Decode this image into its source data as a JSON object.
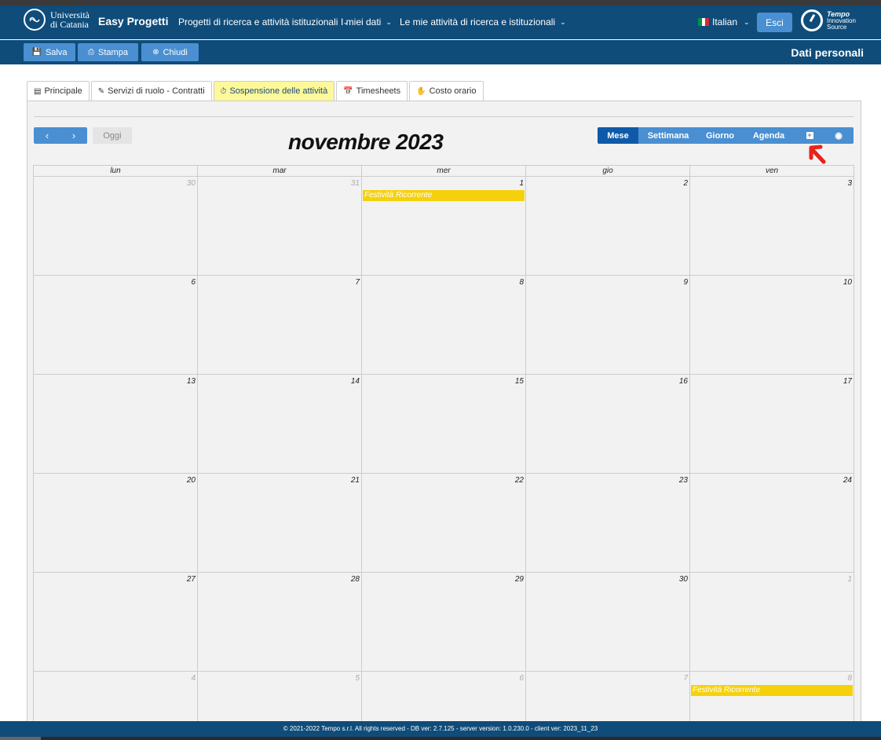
{
  "navbar": {
    "university_line1": "Università",
    "university_line2": "di Catania",
    "app_name": "Easy Progetti",
    "menu": [
      {
        "label": "Progetti di ricerca e attività istituzionali"
      },
      {
        "label": "I miei dati"
      },
      {
        "label": "Le mie attività di ricerca e istituzionali"
      }
    ],
    "language": "Italian",
    "logout_label": "Esci",
    "brand_line1": "Tempo",
    "brand_line2": "Innovation",
    "brand_line3": "Source"
  },
  "toolbar": {
    "save_label": "Salva",
    "print_label": "Stampa",
    "close_label": "Chiudi",
    "page_title": "Dati personali"
  },
  "tabs": [
    {
      "label": "Principale",
      "active": false
    },
    {
      "label": "Servizi di ruolo - Contratti",
      "active": false
    },
    {
      "label": "Sospensione delle attività",
      "active": true
    },
    {
      "label": "Timesheets",
      "active": false
    },
    {
      "label": "Costo orario",
      "active": false
    }
  ],
  "calendar": {
    "title": "novembre 2023",
    "today_label": "Oggi",
    "views": [
      "Mese",
      "Settimana",
      "Giorno",
      "Agenda"
    ],
    "active_view": "Mese",
    "day_headers": [
      "lun",
      "mar",
      "mer",
      "gio",
      "ven"
    ],
    "weeks": [
      [
        {
          "n": "30",
          "other": true
        },
        {
          "n": "31",
          "other": true
        },
        {
          "n": "1",
          "event": "Festività Ricorrente"
        },
        {
          "n": "2"
        },
        {
          "n": "3"
        }
      ],
      [
        {
          "n": "6"
        },
        {
          "n": "7"
        },
        {
          "n": "8"
        },
        {
          "n": "9"
        },
        {
          "n": "10"
        }
      ],
      [
        {
          "n": "13"
        },
        {
          "n": "14"
        },
        {
          "n": "15"
        },
        {
          "n": "16"
        },
        {
          "n": "17"
        }
      ],
      [
        {
          "n": "20"
        },
        {
          "n": "21"
        },
        {
          "n": "22"
        },
        {
          "n": "23"
        },
        {
          "n": "24"
        }
      ],
      [
        {
          "n": "27"
        },
        {
          "n": "28"
        },
        {
          "n": "29"
        },
        {
          "n": "30"
        },
        {
          "n": "1",
          "other": true
        }
      ],
      [
        {
          "n": "4",
          "other": true
        },
        {
          "n": "5",
          "other": true
        },
        {
          "n": "6",
          "other": true
        },
        {
          "n": "7",
          "other": true
        },
        {
          "n": "8",
          "other": true,
          "event": "Festività Ricorrente"
        }
      ]
    ]
  },
  "footer": {
    "text": "© 2021-2022 Tempo s.r.l. All rights reserved - DB ver: 2.7.125 - server version: 1.0.230.0 - client ver: 2023_11_23"
  },
  "colors": {
    "navbar": "#0f4c7a",
    "button": "#4a8fd1",
    "active_tab": "#fdf89a",
    "event": "#f5d10d",
    "annotation": "#e8231b"
  }
}
